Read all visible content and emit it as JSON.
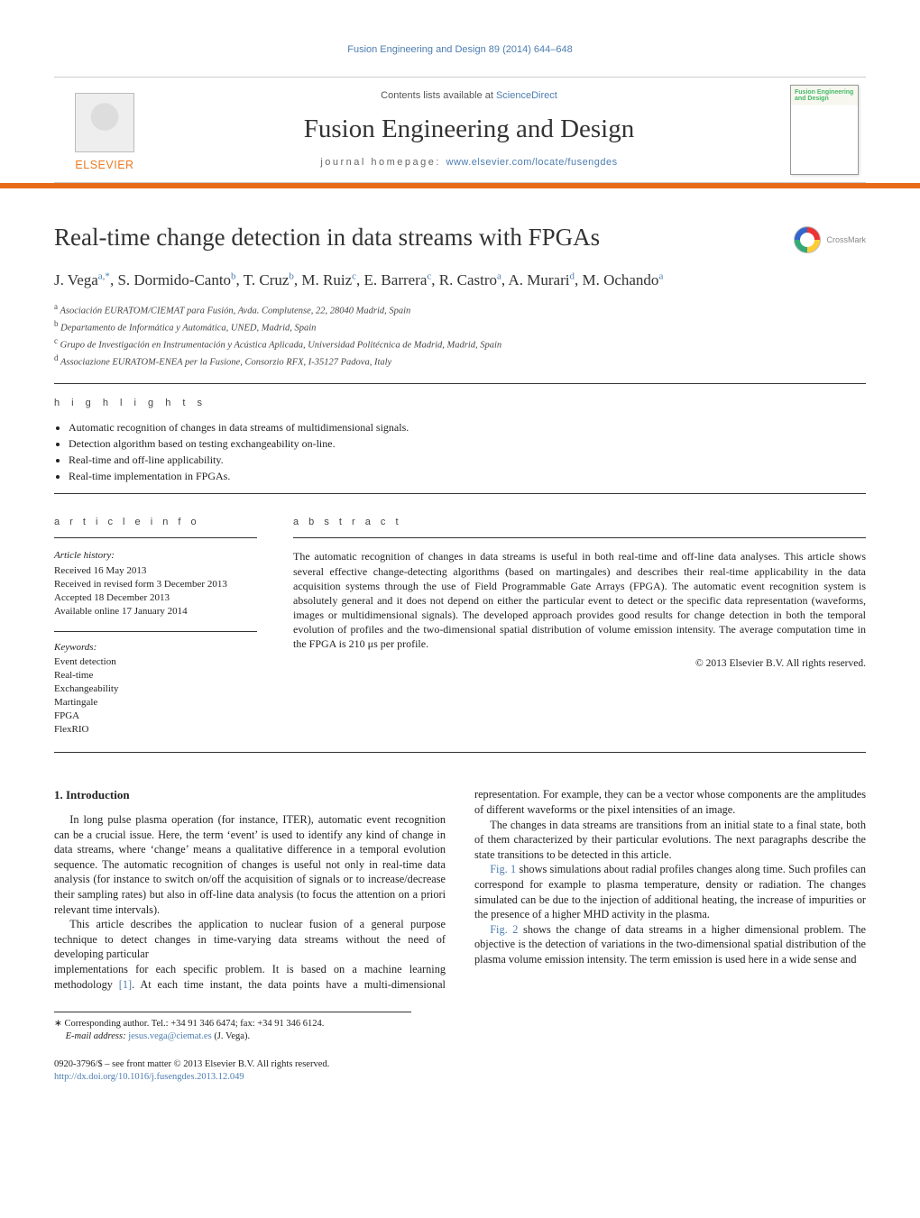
{
  "running_head": "Fusion Engineering and Design 89 (2014) 644–648",
  "masthead": {
    "contents_prefix": "Contents lists available at ",
    "contents_link": "ScienceDirect",
    "journal": "Fusion Engineering and Design",
    "homepage_prefix": "journal homepage: ",
    "homepage_link": "www.elsevier.com/locate/fusengdes",
    "publisher": "ELSEVIER",
    "cover_title": "Fusion Engineering and Design"
  },
  "crossmark_label": "CrossMark",
  "article": {
    "title": "Real-time change detection in data streams with FPGAs",
    "authors_html": "J. Vega|a,*|, S. Dormido-Canto|b|, T. Cruz|b|, M. Ruiz|c|, E. Barrera|c|, R. Castro|a|, A. Murari|d|, M. Ochando|a|",
    "authors": [
      {
        "name": "J. Vega",
        "sup": "a,*"
      },
      {
        "name": "S. Dormido-Canto",
        "sup": "b"
      },
      {
        "name": "T. Cruz",
        "sup": "b"
      },
      {
        "name": "M. Ruiz",
        "sup": "c"
      },
      {
        "name": "E. Barrera",
        "sup": "c"
      },
      {
        "name": "R. Castro",
        "sup": "a"
      },
      {
        "name": "A. Murari",
        "sup": "d"
      },
      {
        "name": "M. Ochando",
        "sup": "a"
      }
    ],
    "affiliations": [
      {
        "sup": "a",
        "text": "Asociación EURATOM/CIEMAT para Fusión, Avda. Complutense, 22, 28040 Madrid, Spain"
      },
      {
        "sup": "b",
        "text": "Departamento de Informática y Automática, UNED, Madrid, Spain"
      },
      {
        "sup": "c",
        "text": "Grupo de Investigación en Instrumentación y Acústica Aplicada, Universidad Politécnica de Madrid, Madrid, Spain"
      },
      {
        "sup": "d",
        "text": "Associazione EURATOM-ENEA per la Fusione, Consorzio RFX, I-35127 Padova, Italy"
      }
    ]
  },
  "labels": {
    "highlights": "h i g h l i g h t s",
    "article_info": "a r t i c l e   i n f o",
    "abstract": "a b s t r a c t",
    "history": "Article history:",
    "keywords": "Keywords:"
  },
  "highlights": [
    "Automatic recognition of changes in data streams of multidimensional signals.",
    "Detection algorithm based on testing exchangeability on-line.",
    "Real-time and off-line applicability.",
    "Real-time implementation in FPGAs."
  ],
  "history": [
    "Received 16 May 2013",
    "Received in revised form 3 December 2013",
    "Accepted 18 December 2013",
    "Available online 17 January 2014"
  ],
  "keywords": [
    "Event detection",
    "Real-time",
    "Exchangeability",
    "Martingale",
    "FPGA",
    "FlexRIO"
  ],
  "abstract": "The automatic recognition of changes in data streams is useful in both real-time and off-line data analyses. This article shows several effective change-detecting algorithms (based on martingales) and describes their real-time applicability in the data acquisition systems through the use of Field Programmable Gate Arrays (FPGA). The automatic event recognition system is absolutely general and it does not depend on either the particular event to detect or the specific data representation (waveforms, images or multidimensional signals). The developed approach provides good results for change detection in both the temporal evolution of profiles and the two-dimensional spatial distribution of volume emission intensity. The average computation time in the FPGA is 210 μs per profile.",
  "abs_copyright": "© 2013 Elsevier B.V. All rights reserved.",
  "section1": {
    "heading": "1.  Introduction",
    "p1": "In long pulse plasma operation (for instance, ITER), automatic event recognition can be a crucial issue. Here, the term ‘event’ is used to identify any kind of change in data streams, where ‘change’ means a qualitative difference in a temporal evolution sequence. The automatic recognition of changes is useful not only in real-time data analysis (for instance to switch on/off the acquisition of signals or to increase/decrease their sampling rates) but also in off-line data analysis (to focus the attention on a priori relevant time intervals).",
    "p2": "This article describes the application to nuclear fusion of a general purpose technique to detect changes in time-varying data streams without the need of developing particular",
    "p3_a": "implementations for each specific problem. It is based on a machine learning methodology ",
    "p3_ref": "[1]",
    "p3_b": ". At each time instant, the data points have a multi-dimensional representation. For example, they can be a vector whose components are the amplitudes of different waveforms or the pixel intensities of an image.",
    "p4": "The changes in data streams are transitions from an initial state to a final state, both of them characterized by their particular evolutions. The next paragraphs describe the state transitions to be detected in this article.",
    "p5_ref": "Fig. 1",
    "p5": " shows simulations about radial profiles changes along time. Such profiles can correspond for example to plasma temperature, density or radiation. The changes simulated can be due to the injection of additional heating, the increase of impurities or the presence of a higher MHD activity in the plasma.",
    "p6_ref": "Fig. 2",
    "p6": " shows the change of data streams in a higher dimensional problem. The objective is the detection of variations in the two-dimensional spatial distribution of the plasma volume emission intensity. The term emission is used here in a wide sense and"
  },
  "footnote": {
    "star": "∗",
    "corr": "Corresponding author. Tel.: +34 91 346 6474; fax: +34 91 346 6124.",
    "email_label": "E-mail address: ",
    "email": "jesus.vega@ciemat.es",
    "email_paren": " (J. Vega)."
  },
  "footer": {
    "line1": "0920-3796/$ – see front matter © 2013 Elsevier B.V. All rights reserved.",
    "doi": "http://dx.doi.org/10.1016/j.fusengdes.2013.12.049"
  }
}
